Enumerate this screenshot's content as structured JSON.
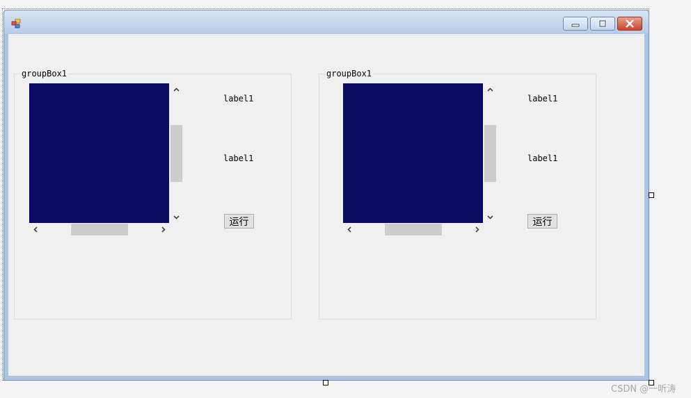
{
  "form": {
    "title": "",
    "controls": {
      "minimize": "minimize",
      "maximize": "maximize",
      "close": "close"
    }
  },
  "groups": [
    {
      "caption": "groupBox1",
      "label_top": "label1",
      "label_bottom": "label1",
      "button": "运行"
    },
    {
      "caption": "groupBox1",
      "label_top": "label1",
      "label_bottom": "label1",
      "button": "运行"
    }
  ],
  "colors": {
    "picture": "#0b0b63",
    "client": "#f0f0f0",
    "scroll_thumb": "#cdcdcd"
  },
  "icons": [
    "app-icon",
    "minimize-icon",
    "maximize-icon",
    "close-icon",
    "chevron-up-icon",
    "chevron-down-icon",
    "chevron-left-icon",
    "chevron-right-icon"
  ],
  "watermark": "CSDN @一听涛"
}
